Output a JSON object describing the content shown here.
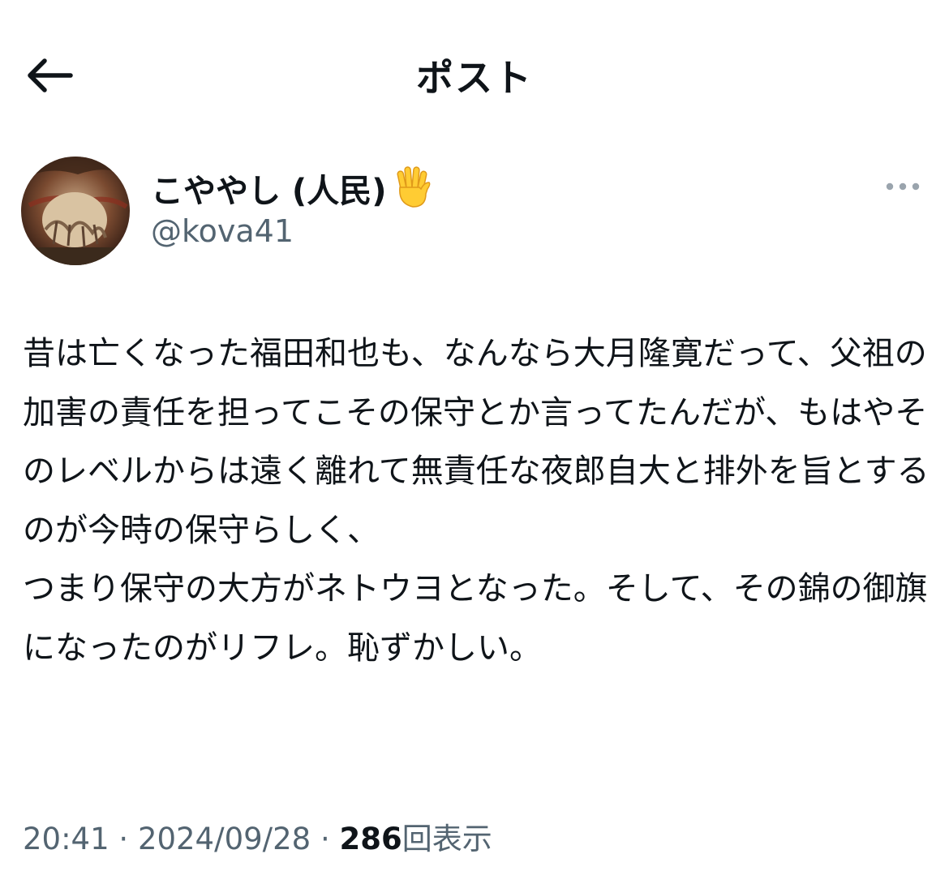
{
  "header": {
    "title": "ポスト",
    "back_icon": "arrow-left-icon"
  },
  "author": {
    "display_name": "こややし (人民)",
    "handle": "@kova41",
    "name_emoji": "raised-hand-fingers-splayed-icon",
    "avatar": "profile-avatar"
  },
  "post": {
    "text": "昔は亡くなった福田和也も、なんなら大月隆寛だって、父祖の加害の責任を担ってこその保守とか言ってたんだが、もはやそのレベルからは遠く離れて無責任な夜郎自大と排外を旨とするのが今時の保守らしく、\nつまり保守の大方がネトウヨとなった。そして、その錦の御旗になったのがリフレ。恥ずかしい。"
  },
  "meta": {
    "time": "20:41",
    "separator": "·",
    "date": "2024/09/28",
    "views_count": "286",
    "views_label": "回表示"
  },
  "colors": {
    "text": "#0f1419",
    "secondary": "#536471",
    "background": "#ffffff"
  }
}
